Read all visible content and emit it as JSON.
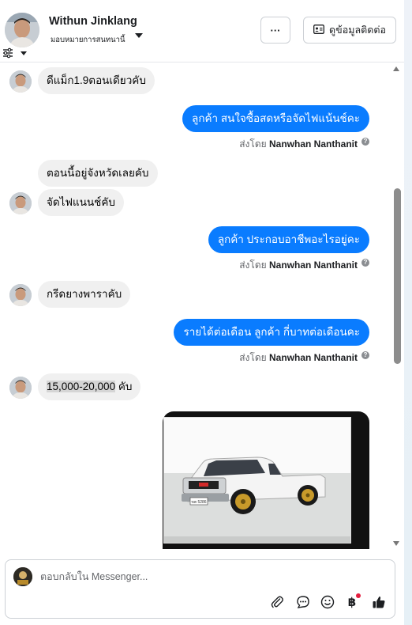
{
  "header": {
    "contact_name": "Withun Jinklang",
    "assign_label": "มอบหมายการสนทนานี้",
    "more_label": "···",
    "contact_info_label": "ดูข้อมูลติดต่อ"
  },
  "messages": [
    {
      "direction": "in",
      "text": "ดีแม็ก1.9ตอนเดียวคับ"
    },
    {
      "direction": "out",
      "text": "ลูกค้า  สนใจซื้อสดหรือจัดไฟแน้นช์คะ",
      "sent_by_prefix": "ส่งโดย",
      "sent_by_name": "Nanwhan Nanthanit"
    },
    {
      "direction": "in",
      "text": "ตอนนี้อยู่จังหวัดเลยคับ"
    },
    {
      "direction": "in",
      "text": "จัดไฟแนนช์คับ"
    },
    {
      "direction": "out",
      "text": "ลูกค้า ประกอบอาชีพอะไรอยู่คะ",
      "sent_by_prefix": "ส่งโดย",
      "sent_by_name": "Nanwhan Nanthanit"
    },
    {
      "direction": "in",
      "text": "กรีดยางพาราคับ"
    },
    {
      "direction": "out",
      "text": "รายได้ต่อเดือน  ลูกค้า  กี่บาทต่อเดือนคะ",
      "sent_by_prefix": "ส่งโดย",
      "sent_by_name": "Nanwhan Nanthanit"
    },
    {
      "direction": "in",
      "text_highlight": "15,000-20,000",
      "text_rest": " คับ"
    }
  ],
  "composer": {
    "placeholder": "ตอบกลับใน Messenger..."
  },
  "icons": [
    "filter-icon",
    "more-icon",
    "contact-card-icon",
    "attach-icon",
    "saved-reply-icon",
    "emoji-icon",
    "baht-icon",
    "thumbs-up-icon"
  ],
  "colors": {
    "accent": "#0a7cff",
    "incoming_bubble": "#f0f0f0",
    "notification_dot": "#e41e3f"
  }
}
